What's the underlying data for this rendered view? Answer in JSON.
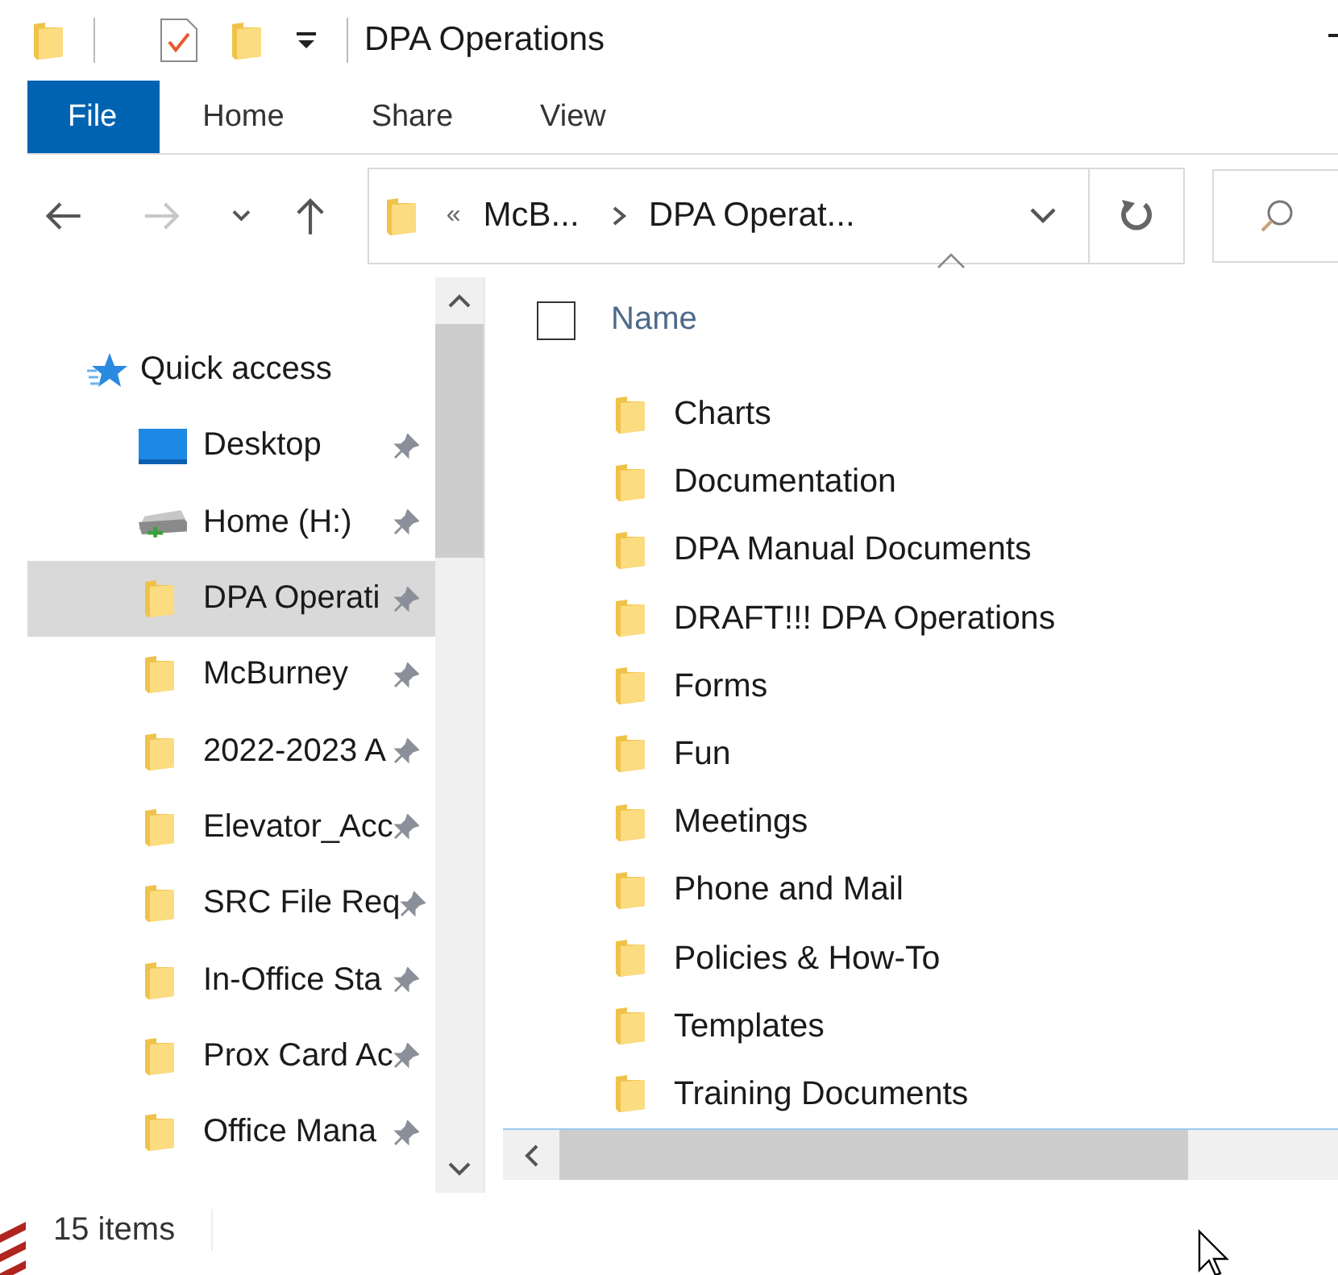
{
  "window": {
    "title": "DPA Operations"
  },
  "ribbon_tabs": [
    {
      "label": "File",
      "kind": "file",
      "selected": false
    },
    {
      "label": "Home",
      "kind": "tab",
      "selected": false
    },
    {
      "label": "Share",
      "kind": "tab",
      "selected": false
    },
    {
      "label": "View",
      "kind": "tab",
      "selected": false
    }
  ],
  "address_bar": {
    "overflow": "«",
    "path": [
      "McB...",
      "DPA Operat..."
    ]
  },
  "navigation": [
    {
      "label": "Quick access",
      "kind": "quick_access",
      "pinned": false,
      "selected": false
    },
    {
      "label": "Desktop",
      "kind": "desktop",
      "pinned": true,
      "selected": false
    },
    {
      "label": "Home (H:)",
      "kind": "drive",
      "pinned": true,
      "selected": false
    },
    {
      "label": "DPA Operati",
      "kind": "folder",
      "pinned": true,
      "selected": true
    },
    {
      "label": "McBurney",
      "kind": "folder",
      "pinned": true,
      "selected": false
    },
    {
      "label": "2022-2023 A",
      "kind": "folder",
      "pinned": true,
      "selected": false
    },
    {
      "label": "Elevator_Acc",
      "kind": "folder",
      "pinned": true,
      "selected": false
    },
    {
      "label": "SRC File Req",
      "kind": "folder",
      "pinned": true,
      "selected": false
    },
    {
      "label": "In-Office Sta",
      "kind": "folder",
      "pinned": true,
      "selected": false
    },
    {
      "label": "Prox Card Ac",
      "kind": "folder",
      "pinned": true,
      "selected": false
    },
    {
      "label": "Office Mana",
      "kind": "folder",
      "pinned": true,
      "selected": false
    }
  ],
  "file_list": {
    "columns": [
      {
        "label": "Name",
        "sorted": true
      }
    ],
    "select_all_checked": false,
    "rows": [
      {
        "name": "Charts"
      },
      {
        "name": "Documentation"
      },
      {
        "name": "DPA Manual Documents"
      },
      {
        "name": "DRAFT!!! DPA Operations"
      },
      {
        "name": "Forms"
      },
      {
        "name": "Fun"
      },
      {
        "name": "Meetings"
      },
      {
        "name": "Phone and Mail"
      },
      {
        "name": "Policies & How-To"
      },
      {
        "name": "Templates"
      },
      {
        "name": "Training Documents"
      }
    ]
  },
  "status_bar": {
    "item_count": "15 items"
  }
}
